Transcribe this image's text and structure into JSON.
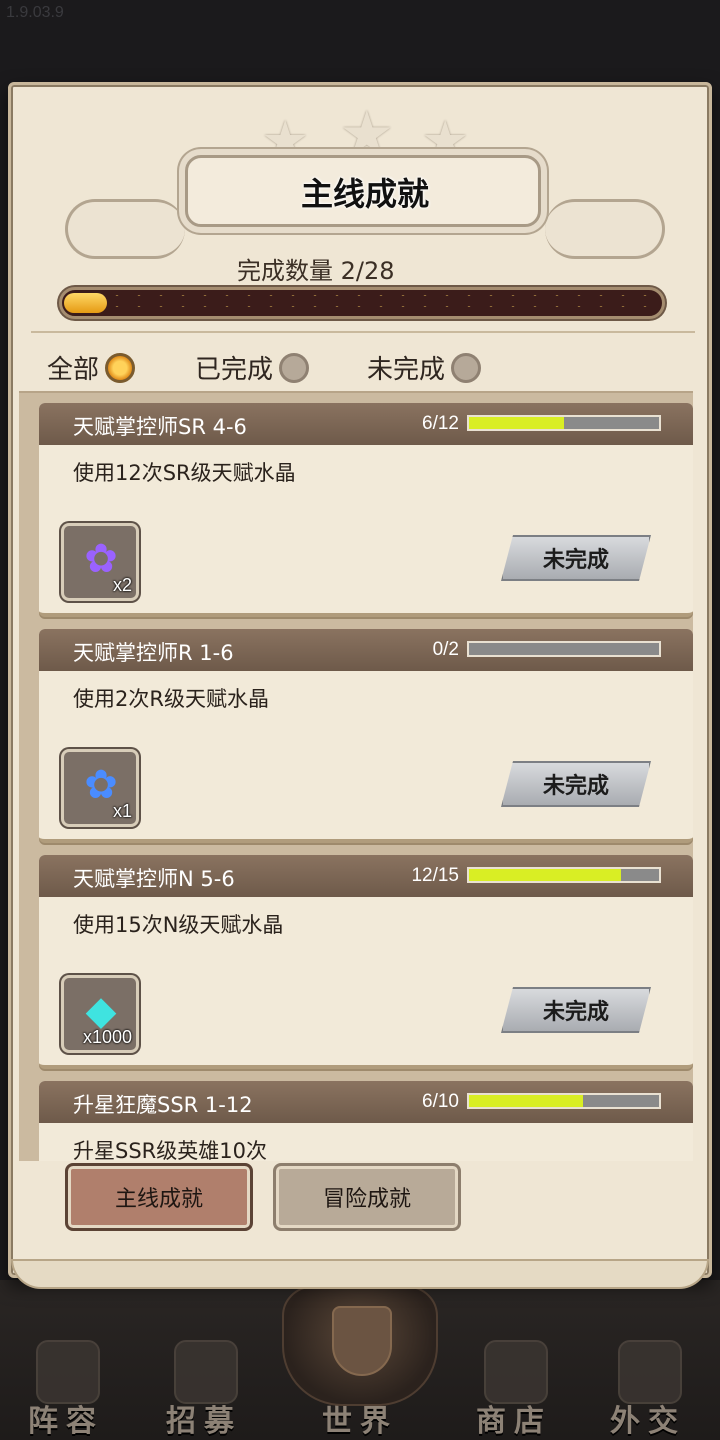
{
  "version": "1.9.03.9",
  "dialog": {
    "title": "主线成就",
    "count_label": "完成数量 2/28",
    "progress": {
      "current": 2,
      "total": 28
    }
  },
  "filters": [
    {
      "label": "全部",
      "selected": true
    },
    {
      "label": "已完成",
      "selected": false
    },
    {
      "label": "未完成",
      "selected": false
    }
  ],
  "achievements": [
    {
      "title": "天赋掌控师SR 4-6",
      "progress": "6/12",
      "current": 6,
      "total": 12,
      "desc": "使用12次SR级天赋水晶",
      "reward_icon": "purple-crystal-icon",
      "reward_qty": "x2",
      "status": "未完成"
    },
    {
      "title": "天赋掌控师R 1-6",
      "progress": "0/2",
      "current": 0,
      "total": 2,
      "desc": "使用2次R级天赋水晶",
      "reward_icon": "blue-crystal-icon",
      "reward_qty": "x1",
      "status": "未完成"
    },
    {
      "title": "天赋掌控师N 5-6",
      "progress": "12/15",
      "current": 12,
      "total": 15,
      "desc": "使用15次N级天赋水晶",
      "reward_icon": "diamond-icon",
      "reward_qty": "x1000",
      "status": "未完成"
    },
    {
      "title": "升星狂魔SSR 1-12",
      "progress": "6/10",
      "current": 6,
      "total": 10,
      "desc": "升星SSR级英雄10次",
      "reward_icon": "",
      "reward_qty": "",
      "status": ""
    }
  ],
  "tabs": [
    {
      "label": "主线成就",
      "active": true
    },
    {
      "label": "冒险成就",
      "active": false
    }
  ],
  "bottom_nav": [
    "阵容",
    "招募",
    "世界",
    "商店",
    "外交"
  ],
  "colors": {
    "bar_fill": "#d9ee24",
    "active_tab": "#b07f6c",
    "header": "#7a6554"
  }
}
